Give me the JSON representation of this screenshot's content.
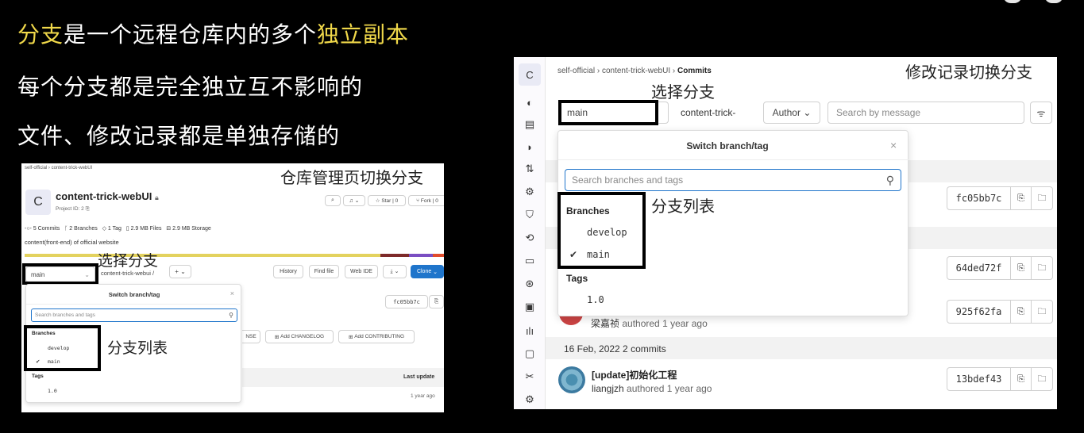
{
  "slide": {
    "line1": {
      "part1": "分支",
      "part2": "是一个远程仓库内的多个",
      "part3": "独立副本"
    },
    "line2": "每个分支都是完全独立互不影响的",
    "line3": "文件、修改记录都是单独存储的"
  },
  "colors": {
    "highlight": "#f0d84a",
    "accent": "#1f75cb"
  },
  "left_panel": {
    "breadcrumb": "self-official  ›  content-trick-webUI",
    "callout_title": "仓库管理页切换分支",
    "avatar_letter": "C",
    "project_title": "content-trick-webUI",
    "project_id": "Project ID: 2",
    "header_buttons": {
      "star": "Star",
      "star_count": "0",
      "fork": "Fork",
      "fork_count": "0"
    },
    "stats": {
      "commits": "5 Commits",
      "branches": "2 Branches",
      "tags": "1 Tag",
      "files": "2.9 MB Files",
      "storage": "2.9 MB Storage"
    },
    "description": "content(front-end) of official website",
    "callout_select": "选择分支",
    "branch_select": "main",
    "path": "content-trick-webui  /",
    "add_btn": "+",
    "toolbar": {
      "history": "History",
      "find_file": "Find file",
      "web_ide": "Web IDE",
      "clone": "Clone"
    },
    "dropdown": {
      "title": "Switch branch/tag",
      "search_placeholder": "Search branches and tags",
      "branches_header": "Branches",
      "branches": [
        "develop",
        "main"
      ],
      "tags_header": "Tags",
      "tags": [
        "1.0"
      ]
    },
    "callout_list": "分支列表",
    "sha": "fc05bb7c",
    "buttons_row": {
      "license": "NSE",
      "changelog": "Add CHANGELOG",
      "contributing": "Add CONTRIBUTING"
    },
    "table_header_last_update": "Last update",
    "table_row_time": "1 year ago"
  },
  "right_panel": {
    "breadcrumb_1": "self-official",
    "breadcrumb_2": "content-trick-webUI",
    "breadcrumb_3": "Commits",
    "callout_title": "修改记录切换分支",
    "callout_select": "选择分支",
    "avatar_letter": "C",
    "branch_select": "main",
    "path": "content-trick-",
    "author_btn": "Author",
    "search_placeholder": "Search by message",
    "dropdown": {
      "title": "Switch branch/tag",
      "search_placeholder": "Search branches and tags",
      "branches_header": "Branches",
      "branches": [
        "develop",
        "main"
      ],
      "tags_header": "Tags",
      "tags": [
        "1.0"
      ]
    },
    "callout_list": "分支列表",
    "commits": [
      {
        "sha": "fc05bb7c"
      },
      {
        "sha": "64ded72f"
      },
      {
        "sha": "925f62fa",
        "author": "梁嘉祯",
        "authored": "authored 1 year ago"
      },
      {
        "sha": "13bdef43",
        "title": "[update]初始化工程",
        "author": "liangjzh",
        "authored": "authored 1 year ago"
      }
    ],
    "date_header": "16 Feb, 2022 2 commits"
  }
}
